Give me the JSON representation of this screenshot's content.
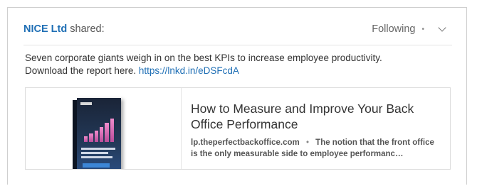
{
  "header": {
    "company": "NICE Ltd",
    "shared_suffix": "shared:",
    "following_label": "Following",
    "separator": "•"
  },
  "post": {
    "text": "Seven corporate giants weigh in on the best KPIs to increase employee productivity.",
    "cta_text": "Download the report here.",
    "link": "https://lnkd.in/eDSFcdA"
  },
  "preview": {
    "title": "How to Measure and Improve Your Back Office Performance",
    "domain": "lp.theperfectbackoffice.com",
    "separator": "•",
    "snippet": "The notion that the front office is the only measurable side to employee performanc…"
  },
  "icons": {
    "menu": "chevron-down-icon"
  }
}
